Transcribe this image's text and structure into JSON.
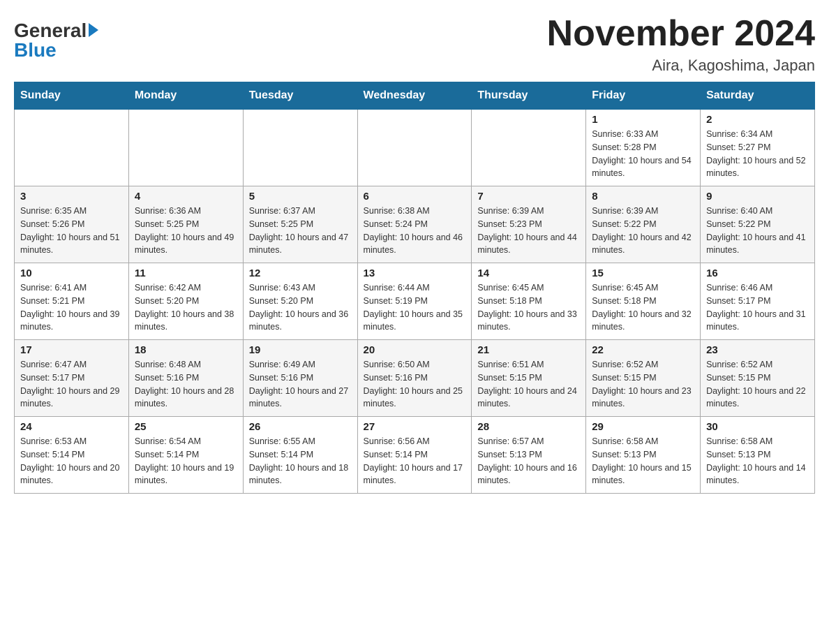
{
  "header": {
    "logo_general": "General",
    "logo_blue": "Blue",
    "month_title": "November 2024",
    "location": "Aira, Kagoshima, Japan"
  },
  "weekdays": [
    "Sunday",
    "Monday",
    "Tuesday",
    "Wednesday",
    "Thursday",
    "Friday",
    "Saturday"
  ],
  "weeks": [
    [
      {
        "day": "",
        "sunrise": "",
        "sunset": "",
        "daylight": ""
      },
      {
        "day": "",
        "sunrise": "",
        "sunset": "",
        "daylight": ""
      },
      {
        "day": "",
        "sunrise": "",
        "sunset": "",
        "daylight": ""
      },
      {
        "day": "",
        "sunrise": "",
        "sunset": "",
        "daylight": ""
      },
      {
        "day": "",
        "sunrise": "",
        "sunset": "",
        "daylight": ""
      },
      {
        "day": "1",
        "sunrise": "Sunrise: 6:33 AM",
        "sunset": "Sunset: 5:28 PM",
        "daylight": "Daylight: 10 hours and 54 minutes."
      },
      {
        "day": "2",
        "sunrise": "Sunrise: 6:34 AM",
        "sunset": "Sunset: 5:27 PM",
        "daylight": "Daylight: 10 hours and 52 minutes."
      }
    ],
    [
      {
        "day": "3",
        "sunrise": "Sunrise: 6:35 AM",
        "sunset": "Sunset: 5:26 PM",
        "daylight": "Daylight: 10 hours and 51 minutes."
      },
      {
        "day": "4",
        "sunrise": "Sunrise: 6:36 AM",
        "sunset": "Sunset: 5:25 PM",
        "daylight": "Daylight: 10 hours and 49 minutes."
      },
      {
        "day": "5",
        "sunrise": "Sunrise: 6:37 AM",
        "sunset": "Sunset: 5:25 PM",
        "daylight": "Daylight: 10 hours and 47 minutes."
      },
      {
        "day": "6",
        "sunrise": "Sunrise: 6:38 AM",
        "sunset": "Sunset: 5:24 PM",
        "daylight": "Daylight: 10 hours and 46 minutes."
      },
      {
        "day": "7",
        "sunrise": "Sunrise: 6:39 AM",
        "sunset": "Sunset: 5:23 PM",
        "daylight": "Daylight: 10 hours and 44 minutes."
      },
      {
        "day": "8",
        "sunrise": "Sunrise: 6:39 AM",
        "sunset": "Sunset: 5:22 PM",
        "daylight": "Daylight: 10 hours and 42 minutes."
      },
      {
        "day": "9",
        "sunrise": "Sunrise: 6:40 AM",
        "sunset": "Sunset: 5:22 PM",
        "daylight": "Daylight: 10 hours and 41 minutes."
      }
    ],
    [
      {
        "day": "10",
        "sunrise": "Sunrise: 6:41 AM",
        "sunset": "Sunset: 5:21 PM",
        "daylight": "Daylight: 10 hours and 39 minutes."
      },
      {
        "day": "11",
        "sunrise": "Sunrise: 6:42 AM",
        "sunset": "Sunset: 5:20 PM",
        "daylight": "Daylight: 10 hours and 38 minutes."
      },
      {
        "day": "12",
        "sunrise": "Sunrise: 6:43 AM",
        "sunset": "Sunset: 5:20 PM",
        "daylight": "Daylight: 10 hours and 36 minutes."
      },
      {
        "day": "13",
        "sunrise": "Sunrise: 6:44 AM",
        "sunset": "Sunset: 5:19 PM",
        "daylight": "Daylight: 10 hours and 35 minutes."
      },
      {
        "day": "14",
        "sunrise": "Sunrise: 6:45 AM",
        "sunset": "Sunset: 5:18 PM",
        "daylight": "Daylight: 10 hours and 33 minutes."
      },
      {
        "day": "15",
        "sunrise": "Sunrise: 6:45 AM",
        "sunset": "Sunset: 5:18 PM",
        "daylight": "Daylight: 10 hours and 32 minutes."
      },
      {
        "day": "16",
        "sunrise": "Sunrise: 6:46 AM",
        "sunset": "Sunset: 5:17 PM",
        "daylight": "Daylight: 10 hours and 31 minutes."
      }
    ],
    [
      {
        "day": "17",
        "sunrise": "Sunrise: 6:47 AM",
        "sunset": "Sunset: 5:17 PM",
        "daylight": "Daylight: 10 hours and 29 minutes."
      },
      {
        "day": "18",
        "sunrise": "Sunrise: 6:48 AM",
        "sunset": "Sunset: 5:16 PM",
        "daylight": "Daylight: 10 hours and 28 minutes."
      },
      {
        "day": "19",
        "sunrise": "Sunrise: 6:49 AM",
        "sunset": "Sunset: 5:16 PM",
        "daylight": "Daylight: 10 hours and 27 minutes."
      },
      {
        "day": "20",
        "sunrise": "Sunrise: 6:50 AM",
        "sunset": "Sunset: 5:16 PM",
        "daylight": "Daylight: 10 hours and 25 minutes."
      },
      {
        "day": "21",
        "sunrise": "Sunrise: 6:51 AM",
        "sunset": "Sunset: 5:15 PM",
        "daylight": "Daylight: 10 hours and 24 minutes."
      },
      {
        "day": "22",
        "sunrise": "Sunrise: 6:52 AM",
        "sunset": "Sunset: 5:15 PM",
        "daylight": "Daylight: 10 hours and 23 minutes."
      },
      {
        "day": "23",
        "sunrise": "Sunrise: 6:52 AM",
        "sunset": "Sunset: 5:15 PM",
        "daylight": "Daylight: 10 hours and 22 minutes."
      }
    ],
    [
      {
        "day": "24",
        "sunrise": "Sunrise: 6:53 AM",
        "sunset": "Sunset: 5:14 PM",
        "daylight": "Daylight: 10 hours and 20 minutes."
      },
      {
        "day": "25",
        "sunrise": "Sunrise: 6:54 AM",
        "sunset": "Sunset: 5:14 PM",
        "daylight": "Daylight: 10 hours and 19 minutes."
      },
      {
        "day": "26",
        "sunrise": "Sunrise: 6:55 AM",
        "sunset": "Sunset: 5:14 PM",
        "daylight": "Daylight: 10 hours and 18 minutes."
      },
      {
        "day": "27",
        "sunrise": "Sunrise: 6:56 AM",
        "sunset": "Sunset: 5:14 PM",
        "daylight": "Daylight: 10 hours and 17 minutes."
      },
      {
        "day": "28",
        "sunrise": "Sunrise: 6:57 AM",
        "sunset": "Sunset: 5:13 PM",
        "daylight": "Daylight: 10 hours and 16 minutes."
      },
      {
        "day": "29",
        "sunrise": "Sunrise: 6:58 AM",
        "sunset": "Sunset: 5:13 PM",
        "daylight": "Daylight: 10 hours and 15 minutes."
      },
      {
        "day": "30",
        "sunrise": "Sunrise: 6:58 AM",
        "sunset": "Sunset: 5:13 PM",
        "daylight": "Daylight: 10 hours and 14 minutes."
      }
    ]
  ]
}
